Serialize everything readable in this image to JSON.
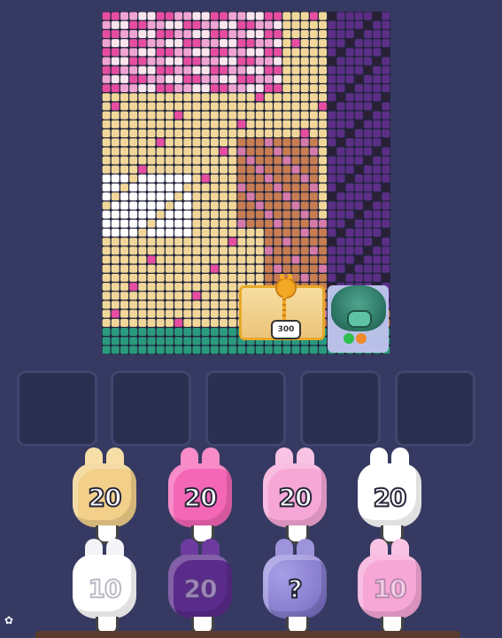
{
  "board": {
    "palette": [
      "#f0a4d2",
      "#f2d79a",
      "#ffffff",
      "#5c2f87",
      "#2a2035",
      "#c77c52",
      "#e64da0",
      "#2a9a7e",
      "#fbe6ee",
      "#d67aa9"
    ],
    "gate_tag": "300"
  },
  "queue": {
    "slot_count": 5
  },
  "bunnies": {
    "row1": [
      {
        "label": "20",
        "color": "#f2d08a",
        "ear": "#f7dea6"
      },
      {
        "label": "20",
        "color": "#f466b6",
        "ear": "#f88cc8"
      },
      {
        "label": "20",
        "color": "#f6a7d6",
        "ear": "#f9c4e4"
      },
      {
        "label": "20",
        "color": "#ffffff",
        "ear": "#ffffff"
      }
    ],
    "row2": [
      {
        "label": "10",
        "color": "#ffffff",
        "ear": "#f3f3f8",
        "locked": true
      },
      {
        "label": "20",
        "color": "#5a2b8a",
        "ear": "#6d3ba0",
        "locked": true
      },
      {
        "label": "?",
        "color": "#8a7fd0",
        "ear": "#9d94db",
        "mystery": true
      },
      {
        "label": "10",
        "color": "#f6a7d6",
        "ear": "#f9c4e4",
        "locked": true
      }
    ]
  },
  "icons": {
    "corner": "gear-icon"
  }
}
